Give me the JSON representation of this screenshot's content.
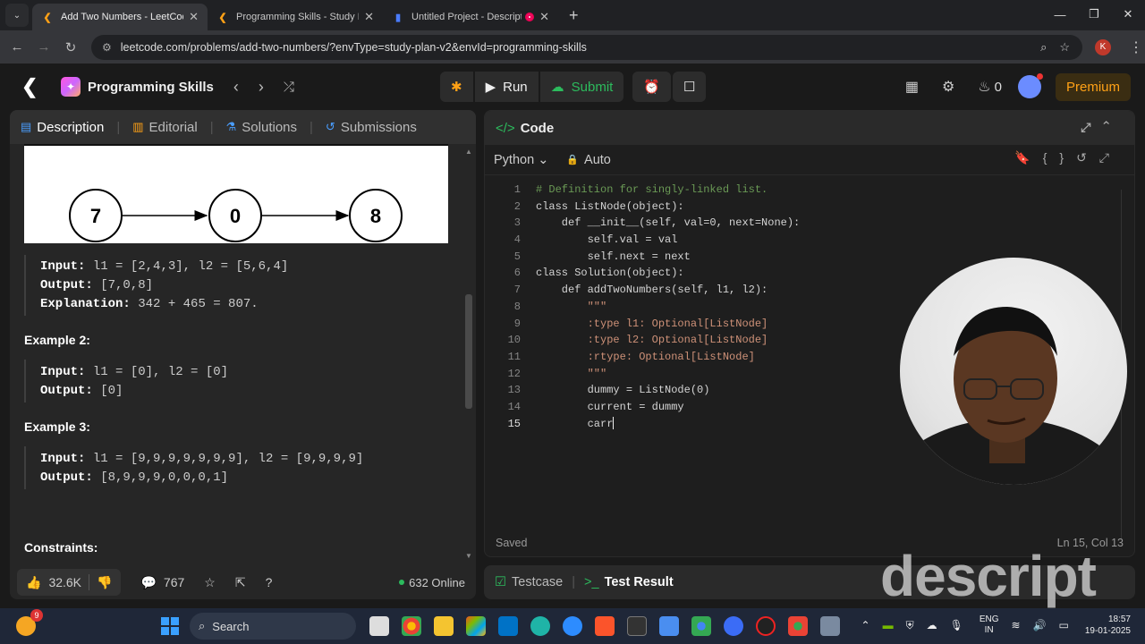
{
  "browser": {
    "tabs": [
      {
        "title": "Add Two Numbers - LeetCode",
        "active": true
      },
      {
        "title": "Programming Skills - Study Plan",
        "active": false
      },
      {
        "title": "Untitled Project - Descript",
        "active": false
      }
    ],
    "url": "leetcode.com/problems/add-two-numbers/?envType=study-plan-v2&envId=programming-skills",
    "profile_initial": "K"
  },
  "nav": {
    "study_plan": "Programming Skills",
    "run": "Run",
    "submit": "Submit",
    "streak": "0",
    "premium": "Premium"
  },
  "problem": {
    "tabs": [
      "Description",
      "Editorial",
      "Solutions",
      "Submissions"
    ],
    "figure_nodes": [
      "7",
      "0",
      "8"
    ],
    "example1": {
      "input_label": "Input:",
      "input": "l1 = [2,4,3], l2 = [5,6,4]",
      "output_label": "Output:",
      "output": "[7,0,8]",
      "explanation_label": "Explanation:",
      "explanation": "342 + 465 = 807."
    },
    "example2": {
      "title": "Example 2:",
      "input_label": "Input:",
      "input": "l1 = [0], l2 = [0]",
      "output_label": "Output:",
      "output": "[0]"
    },
    "example3": {
      "title": "Example 3:",
      "input_label": "Input:",
      "input": "l1 = [9,9,9,9,9,9,9], l2 = [9,9,9,9]",
      "output_label": "Output:",
      "output": "[8,9,9,9,0,0,0,1]"
    },
    "constraints": "Constraints:",
    "likes": "32.6K",
    "comments": "767",
    "online": "632 Online"
  },
  "editor": {
    "title": "Code",
    "language": "Python",
    "mode": "Auto",
    "status": "Saved",
    "cursor": "Ln 15, Col 13",
    "lines": [
      "# Definition for singly-linked list.",
      "class ListNode(object):",
      "    def __init__(self, val=0, next=None):",
      "        self.val = val",
      "        self.next = next",
      "class Solution(object):",
      "    def addTwoNumbers(self, l1, l2):",
      "        \"\"\"",
      "        :type l1: Optional[ListNode]",
      "        :type l2: Optional[ListNode]",
      "        :rtype: Optional[ListNode]",
      "        \"\"\"",
      "        dummy = ListNode(0)",
      "        current = dummy",
      "        carr"
    ]
  },
  "bottom_tabs": [
    "Testcase",
    "Test Result"
  ],
  "watermark": "descript",
  "taskbar": {
    "search": "Search",
    "weather_badge": "9",
    "lang1": "ENG",
    "lang2": "IN",
    "time": "18:57",
    "date": "19-01-2025"
  }
}
